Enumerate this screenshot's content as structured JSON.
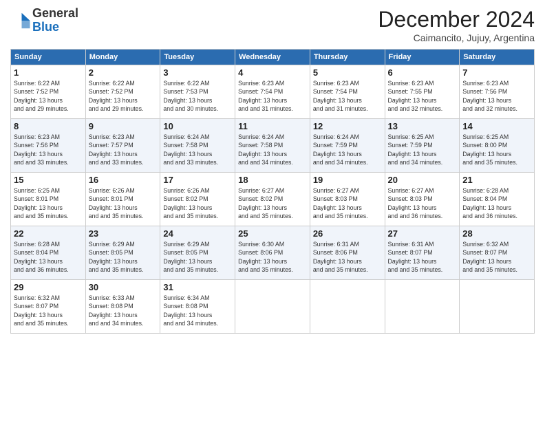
{
  "header": {
    "logo_general": "General",
    "logo_blue": "Blue",
    "month_title": "December 2024",
    "subtitle": "Caimancito, Jujuy, Argentina"
  },
  "weekdays": [
    "Sunday",
    "Monday",
    "Tuesday",
    "Wednesday",
    "Thursday",
    "Friday",
    "Saturday"
  ],
  "days": [
    {
      "day": 1,
      "sunrise": "6:22 AM",
      "sunset": "7:52 PM",
      "daylight": "13 hours and 29 minutes."
    },
    {
      "day": 2,
      "sunrise": "6:22 AM",
      "sunset": "7:52 PM",
      "daylight": "13 hours and 29 minutes."
    },
    {
      "day": 3,
      "sunrise": "6:22 AM",
      "sunset": "7:53 PM",
      "daylight": "13 hours and 30 minutes."
    },
    {
      "day": 4,
      "sunrise": "6:23 AM",
      "sunset": "7:54 PM",
      "daylight": "13 hours and 31 minutes."
    },
    {
      "day": 5,
      "sunrise": "6:23 AM",
      "sunset": "7:54 PM",
      "daylight": "13 hours and 31 minutes."
    },
    {
      "day": 6,
      "sunrise": "6:23 AM",
      "sunset": "7:55 PM",
      "daylight": "13 hours and 32 minutes."
    },
    {
      "day": 7,
      "sunrise": "6:23 AM",
      "sunset": "7:56 PM",
      "daylight": "13 hours and 32 minutes."
    },
    {
      "day": 8,
      "sunrise": "6:23 AM",
      "sunset": "7:56 PM",
      "daylight": "13 hours and 33 minutes."
    },
    {
      "day": 9,
      "sunrise": "6:23 AM",
      "sunset": "7:57 PM",
      "daylight": "13 hours and 33 minutes."
    },
    {
      "day": 10,
      "sunrise": "6:24 AM",
      "sunset": "7:58 PM",
      "daylight": "13 hours and 33 minutes."
    },
    {
      "day": 11,
      "sunrise": "6:24 AM",
      "sunset": "7:58 PM",
      "daylight": "13 hours and 34 minutes."
    },
    {
      "day": 12,
      "sunrise": "6:24 AM",
      "sunset": "7:59 PM",
      "daylight": "13 hours and 34 minutes."
    },
    {
      "day": 13,
      "sunrise": "6:25 AM",
      "sunset": "7:59 PM",
      "daylight": "13 hours and 34 minutes."
    },
    {
      "day": 14,
      "sunrise": "6:25 AM",
      "sunset": "8:00 PM",
      "daylight": "13 hours and 35 minutes."
    },
    {
      "day": 15,
      "sunrise": "6:25 AM",
      "sunset": "8:01 PM",
      "daylight": "13 hours and 35 minutes."
    },
    {
      "day": 16,
      "sunrise": "6:26 AM",
      "sunset": "8:01 PM",
      "daylight": "13 hours and 35 minutes."
    },
    {
      "day": 17,
      "sunrise": "6:26 AM",
      "sunset": "8:02 PM",
      "daylight": "13 hours and 35 minutes."
    },
    {
      "day": 18,
      "sunrise": "6:27 AM",
      "sunset": "8:02 PM",
      "daylight": "13 hours and 35 minutes."
    },
    {
      "day": 19,
      "sunrise": "6:27 AM",
      "sunset": "8:03 PM",
      "daylight": "13 hours and 35 minutes."
    },
    {
      "day": 20,
      "sunrise": "6:27 AM",
      "sunset": "8:03 PM",
      "daylight": "13 hours and 36 minutes."
    },
    {
      "day": 21,
      "sunrise": "6:28 AM",
      "sunset": "8:04 PM",
      "daylight": "13 hours and 36 minutes."
    },
    {
      "day": 22,
      "sunrise": "6:28 AM",
      "sunset": "8:04 PM",
      "daylight": "13 hours and 36 minutes."
    },
    {
      "day": 23,
      "sunrise": "6:29 AM",
      "sunset": "8:05 PM",
      "daylight": "13 hours and 35 minutes."
    },
    {
      "day": 24,
      "sunrise": "6:29 AM",
      "sunset": "8:05 PM",
      "daylight": "13 hours and 35 minutes."
    },
    {
      "day": 25,
      "sunrise": "6:30 AM",
      "sunset": "8:06 PM",
      "daylight": "13 hours and 35 minutes."
    },
    {
      "day": 26,
      "sunrise": "6:31 AM",
      "sunset": "8:06 PM",
      "daylight": "13 hours and 35 minutes."
    },
    {
      "day": 27,
      "sunrise": "6:31 AM",
      "sunset": "8:07 PM",
      "daylight": "13 hours and 35 minutes."
    },
    {
      "day": 28,
      "sunrise": "6:32 AM",
      "sunset": "8:07 PM",
      "daylight": "13 hours and 35 minutes."
    },
    {
      "day": 29,
      "sunrise": "6:32 AM",
      "sunset": "8:07 PM",
      "daylight": "13 hours and 35 minutes."
    },
    {
      "day": 30,
      "sunrise": "6:33 AM",
      "sunset": "8:08 PM",
      "daylight": "13 hours and 34 minutes."
    },
    {
      "day": 31,
      "sunrise": "6:34 AM",
      "sunset": "8:08 PM",
      "daylight": "13 hours and 34 minutes."
    }
  ]
}
